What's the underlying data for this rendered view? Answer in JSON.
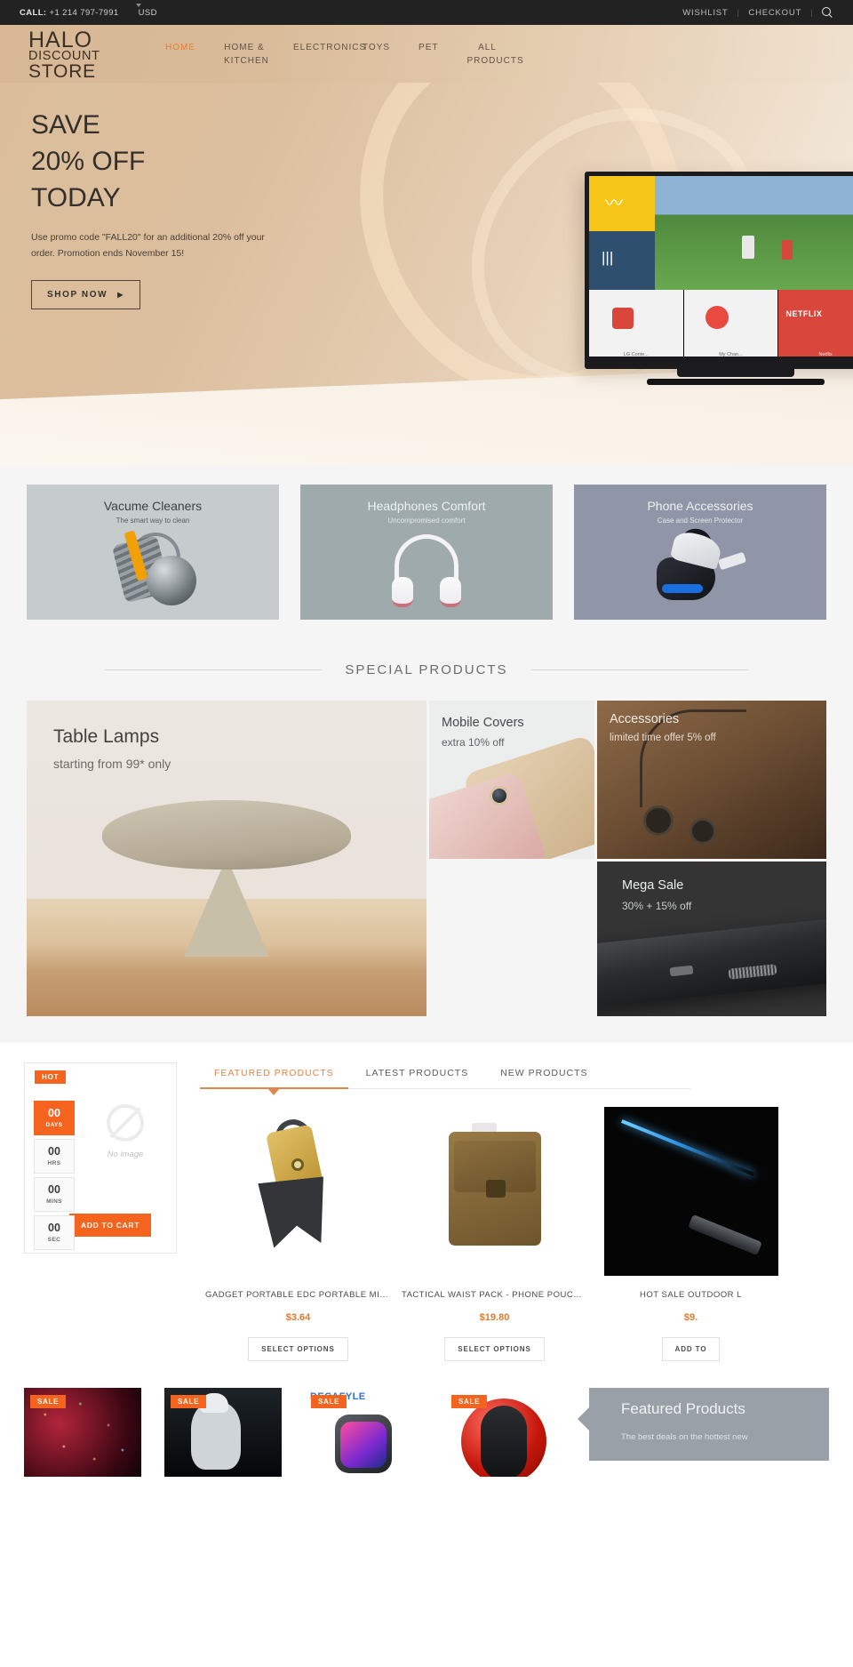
{
  "topbar": {
    "call_label": "CALL:",
    "phone": "+1 214 797-7991",
    "currency": "USD",
    "wishlist": "WISHLIST",
    "checkout": "CHECKOUT",
    "separator": "|"
  },
  "header": {
    "logo_line1": "HALO",
    "logo_line2": "DISCOUNT",
    "logo_line3": "STORE",
    "nav": [
      {
        "label": "HOME",
        "active": true
      },
      {
        "label": "HOME & KITCHEN",
        "active": false
      },
      {
        "label": "ELECTRONICS",
        "active": false
      },
      {
        "label": "TOYS",
        "active": false
      },
      {
        "label": "PET",
        "active": false
      },
      {
        "label": "ALL PRODUCTS",
        "active": false
      }
    ]
  },
  "hero": {
    "line1": "SAVE",
    "line2": "20% OFF",
    "line3": "TODAY",
    "description": "Use promo code \"FALL20\" for an additional 20% off your order. Promotion ends November 15!",
    "cta": "SHOP NOW",
    "cta_arrow": "▶"
  },
  "categories": [
    {
      "title": "Vacume Cleaners",
      "subtitle": "The smart way to clean",
      "bg": "#c6cbcc"
    },
    {
      "title": "Headphones Comfort",
      "subtitle": "Uncompromised comfort",
      "bg": "#9eaaab"
    },
    {
      "title": "Phone Accessories",
      "subtitle": "Case and Screen Protector",
      "bg": "#9096a8"
    }
  ],
  "special_section": {
    "heading": "SPECIAL PRODUCTS",
    "tiles": {
      "lamps": {
        "title": "Table Lamps",
        "subtitle": "starting from 99* only"
      },
      "covers": {
        "title": "Mobile Covers",
        "subtitle": "extra 10% off"
      },
      "accessories": {
        "title": "Accessories",
        "subtitle": "limited time offer 5% off"
      },
      "mega": {
        "title": "Mega Sale",
        "subtitle": "30% + 15% off"
      }
    }
  },
  "deal": {
    "badge": "HOT",
    "countdown": [
      {
        "value": "00",
        "unit": "DAYS",
        "highlight": true
      },
      {
        "value": "00",
        "unit": "HRS",
        "highlight": false
      },
      {
        "value": "00",
        "unit": "MINS",
        "highlight": false
      },
      {
        "value": "00",
        "unit": "SEC",
        "highlight": false
      }
    ],
    "no_image_text": "No image",
    "add_to_cart": "ADD TO CART"
  },
  "product_tabs": [
    {
      "label": "FEATURED PRODUCTS",
      "active": true
    },
    {
      "label": "LATEST PRODUCTS",
      "active": false
    },
    {
      "label": "NEW PRODUCTS",
      "active": false
    }
  ],
  "products": [
    {
      "name": "GADGET PORTABLE EDC PORTABLE MINI U…",
      "price": "$3.64",
      "button": "SELECT OPTIONS"
    },
    {
      "name": "TACTICAL WAIST PACK - PHONE POUCH BE…",
      "price": "$19.80",
      "button": "SELECT OPTIONS"
    },
    {
      "name": "HOT SALE OUTDOOR L",
      "price": "$9.",
      "button": "ADD TO"
    }
  ],
  "sale_strip": {
    "badge": "SALE",
    "items": [
      {
        "badge": "SALE"
      },
      {
        "badge": "SALE"
      },
      {
        "badge": "SALE",
        "brand": "DECAFYLE"
      },
      {
        "badge": "SALE"
      }
    ],
    "featured_panel": {
      "title": "Featured Products",
      "subtitle": "The best deals on the hottest new"
    }
  },
  "colors": {
    "accent_orange": "#f4641e",
    "tab_active": "#e0864a",
    "price": "#e07a30",
    "topbar_bg": "#222222"
  }
}
